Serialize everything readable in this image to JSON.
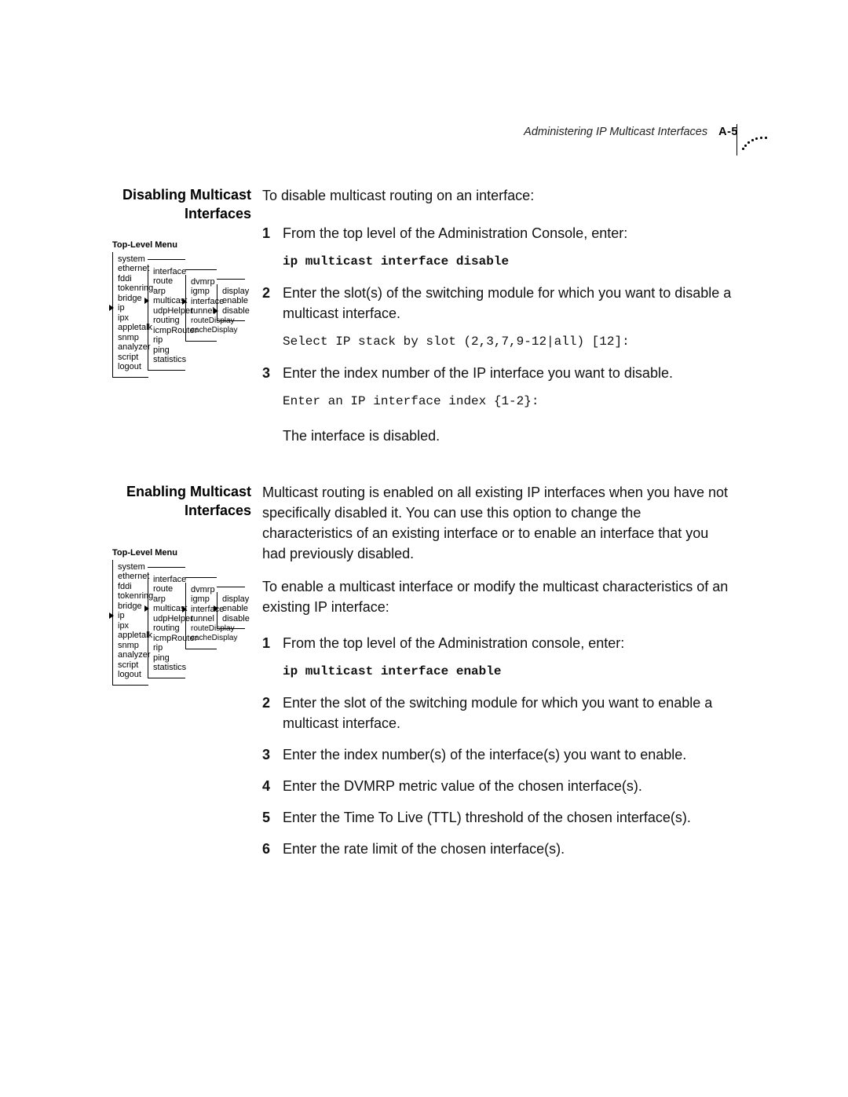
{
  "header": {
    "title": "Administering IP Multicast Interfaces",
    "page_number": "A-5"
  },
  "menu_title": "Top-Level Menu",
  "menu": {
    "col1": [
      "system",
      "ethernet",
      "fddi",
      "tokenring",
      "bridge",
      "ip",
      "ipx",
      "appletalk",
      "snmp",
      "analyzer",
      "script",
      "logout"
    ],
    "col1_selected": "ip",
    "col2": [
      "interface",
      "route",
      "arp",
      "multicast",
      "udpHelper",
      "routing",
      "icmpRouter",
      "rip",
      "ping",
      "statistics"
    ],
    "col2_selected": "multicast",
    "col3": [
      "dvmrp",
      "igmp",
      "interface",
      "tunnel",
      "routeDisplay",
      "cacheDisplay"
    ],
    "col3_selected": "interface",
    "col4_disable": [
      "display",
      "enable",
      "disable"
    ],
    "col4_disable_selected": "disable",
    "col4_enable": [
      "display",
      "enable",
      "disable"
    ],
    "col4_enable_selected": "enable"
  },
  "sections": {
    "disable": {
      "heading": "Disabling Multicast Interfaces",
      "intro": "To disable multicast routing on an interface:",
      "steps": [
        {
          "n": "1",
          "text": "From the top level of the Administration Console, enter:",
          "code": "ip multicast interface disable",
          "code_style": "cmd"
        },
        {
          "n": "2",
          "text": "Enter the slot(s) of the switching module for which you want to disable a multicast interface.",
          "code": "Select IP stack by slot (2,3,7,9-12|all) [12]:",
          "code_style": "prompt"
        },
        {
          "n": "3",
          "text": "Enter the index number of the IP interface you want to disable.",
          "code": "Enter an IP interface index {1-2}:",
          "code_style": "prompt"
        }
      ],
      "closing": "The interface is disabled."
    },
    "enable": {
      "heading": "Enabling Multicast Interfaces",
      "intro1": "Multicast routing is enabled on all existing IP interfaces when you have not specifically disabled it. You can use this option to change the characteristics of an existing interface or to enable an interface that you had previously disabled.",
      "intro2": "To enable a multicast interface or modify the multicast characteristics of an existing IP interface:",
      "steps": [
        {
          "n": "1",
          "text": "From the top level of the Administration console, enter:",
          "code": "ip multicast interface enable",
          "code_style": "cmd"
        },
        {
          "n": "2",
          "text": "Enter the slot of the switching module for which you want to enable a multicast interface."
        },
        {
          "n": "3",
          "text": "Enter the index number(s) of the interface(s) you want to enable."
        },
        {
          "n": "4",
          "text": "Enter the DVMRP metric value of the chosen interface(s)."
        },
        {
          "n": "5",
          "text": "Enter the Time To Live (TTL) threshold of the chosen interface(s)."
        },
        {
          "n": "6",
          "text": "Enter the rate limit of the chosen interface(s)."
        }
      ]
    }
  }
}
